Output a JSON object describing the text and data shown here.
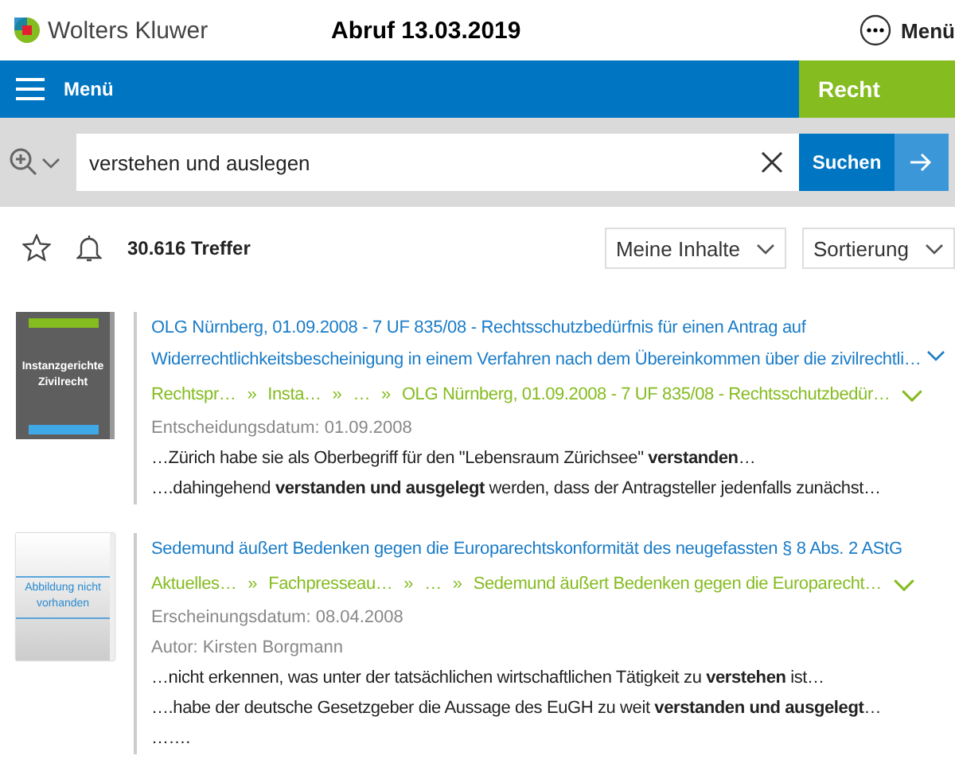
{
  "header": {
    "brand": "Wolters Kluwer",
    "retrieval": "Abruf 13.03.2019",
    "menu_label": "Menü"
  },
  "navbar": {
    "menu_label": "Menü",
    "section": "Recht"
  },
  "search": {
    "value": "verstehen und auslegen",
    "button": "Suchen"
  },
  "toolbar": {
    "hits": "30.616 Treffer",
    "filters": [
      "Meine Inhalte",
      "Sortierung"
    ]
  },
  "results": [
    {
      "kind": "book",
      "separator": "»",
      "cover_text": "Instanzgerichte Zivilrecht",
      "title": "OLG Nürnberg, 01.09.2008 - 7 UF 835/08 - Rechtsschutzbedürfnis für einen Antrag auf Widerrechtlichkeitsbescheinigung in einem Verfahren nach dem Übereinkommen über die zivilrechtli…",
      "expandable": true,
      "breadcrumb": [
        "Rechtspr…",
        "Insta…",
        "…",
        "OLG Nürnberg, 01.09.2008 - 7 UF 835/08 - Rechtsschutzbedür…"
      ],
      "meta": [
        "Entscheidungsdatum: 01.09.2008"
      ],
      "snippets": [
        "…Zürich habe sie als Oberbegriff für den \"Lebensraum Zürichsee\" **verstanden**…",
        "….dahingehend **verstanden und ausgelegt** werden, dass der Antragsteller jedenfalls zunächst…"
      ]
    },
    {
      "kind": "placeholder",
      "separator": "»",
      "cover_text": "Abbildung nicht vorhanden",
      "title": "Sedemund äußert Bedenken gegen die Europarechtskonformität des neugefassten § 8 Abs. 2 AStG",
      "expandable": false,
      "breadcrumb": [
        "Aktuelles…",
        "Fachpresseau…",
        "…",
        "Sedemund äußert Bedenken gegen die Europarecht…"
      ],
      "meta": [
        "Erscheinungsdatum: 08.04.2008",
        "Autor: Kirsten Borgmann"
      ],
      "snippets": [
        "…nicht erkennen, was unter der tatsächlichen wirtschaftlichen Tätigkeit zu **verstehen** ist…",
        "….habe der deutsche Gesetzgeber die Aussage des EuGH zu weit **verstanden und ausgelegt**…",
        "……."
      ]
    }
  ]
}
